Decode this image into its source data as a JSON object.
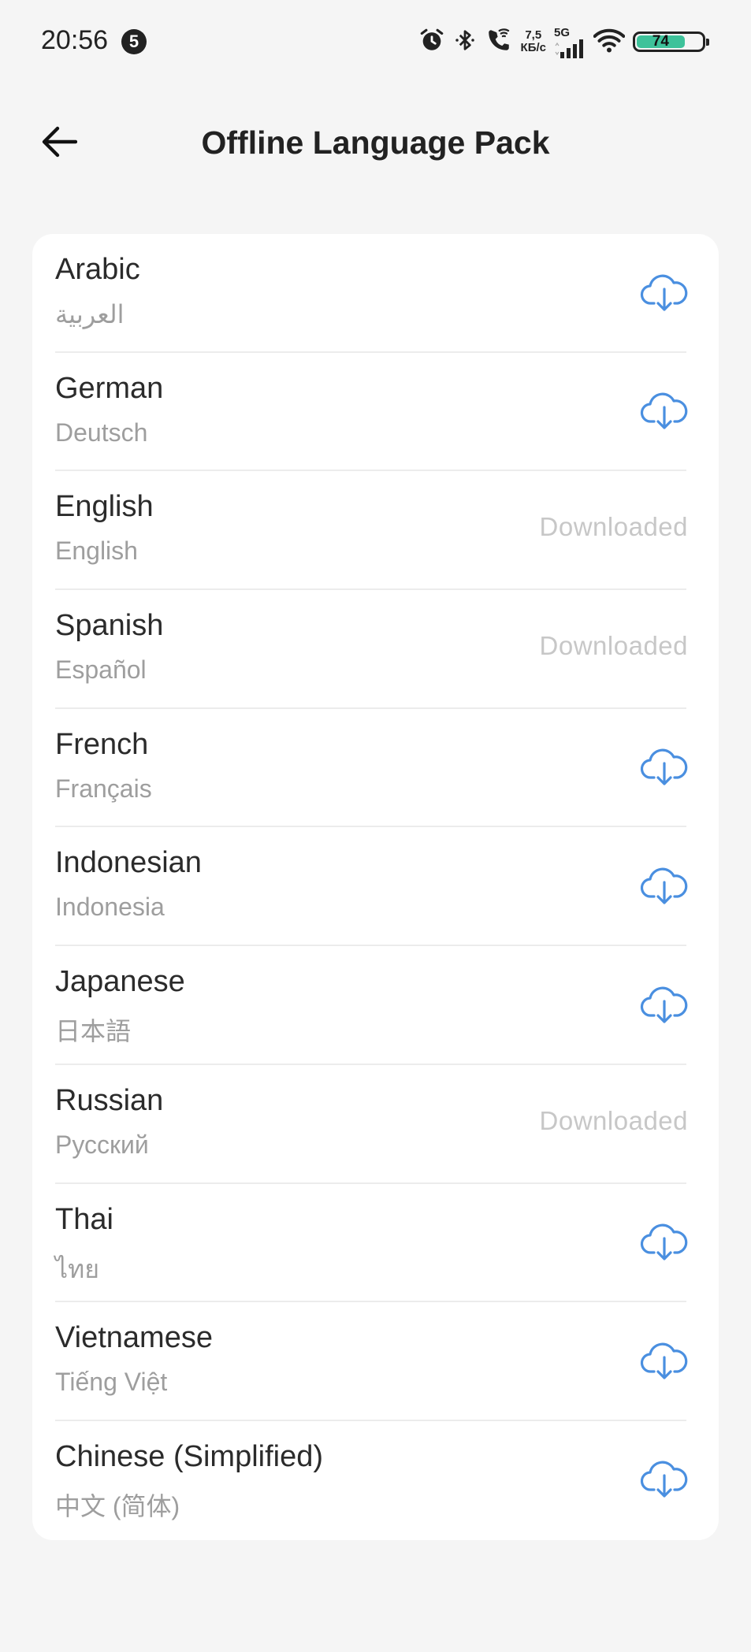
{
  "status_bar": {
    "time": "20:56",
    "notification_count": "5",
    "net_speed_value": "7,5",
    "net_speed_unit": "КБ/с",
    "network_type": "5G",
    "battery_level": "74",
    "battery_percent": 74,
    "icons": [
      "alarm-icon",
      "bluetooth-icon",
      "wifi-calling-icon",
      "signal-icon",
      "wifi-icon",
      "battery-icon"
    ]
  },
  "header": {
    "title": "Offline Language Pack",
    "back_icon": "arrow-left-icon"
  },
  "accent_color": "#4a8fe0",
  "languages": [
    {
      "name": "Arabic",
      "native": "العربية",
      "status": "download"
    },
    {
      "name": "German",
      "native": "Deutsch",
      "status": "download"
    },
    {
      "name": "English",
      "native": "English",
      "status": "Downloaded"
    },
    {
      "name": "Spanish",
      "native": "Español",
      "status": "Downloaded"
    },
    {
      "name": "French",
      "native": "Français",
      "status": "download"
    },
    {
      "name": "Indonesian",
      "native": "Indonesia",
      "status": "download"
    },
    {
      "name": "Japanese",
      "native": "日本語",
      "status": "download"
    },
    {
      "name": "Russian",
      "native": "Русский",
      "status": "Downloaded"
    },
    {
      "name": "Thai",
      "native": "ไทย",
      "status": "download"
    },
    {
      "name": "Vietnamese",
      "native": "Tiếng Việt",
      "status": "download"
    },
    {
      "name": "Chinese (Simplified)",
      "native": "中文 (简体)",
      "status": "download"
    }
  ]
}
